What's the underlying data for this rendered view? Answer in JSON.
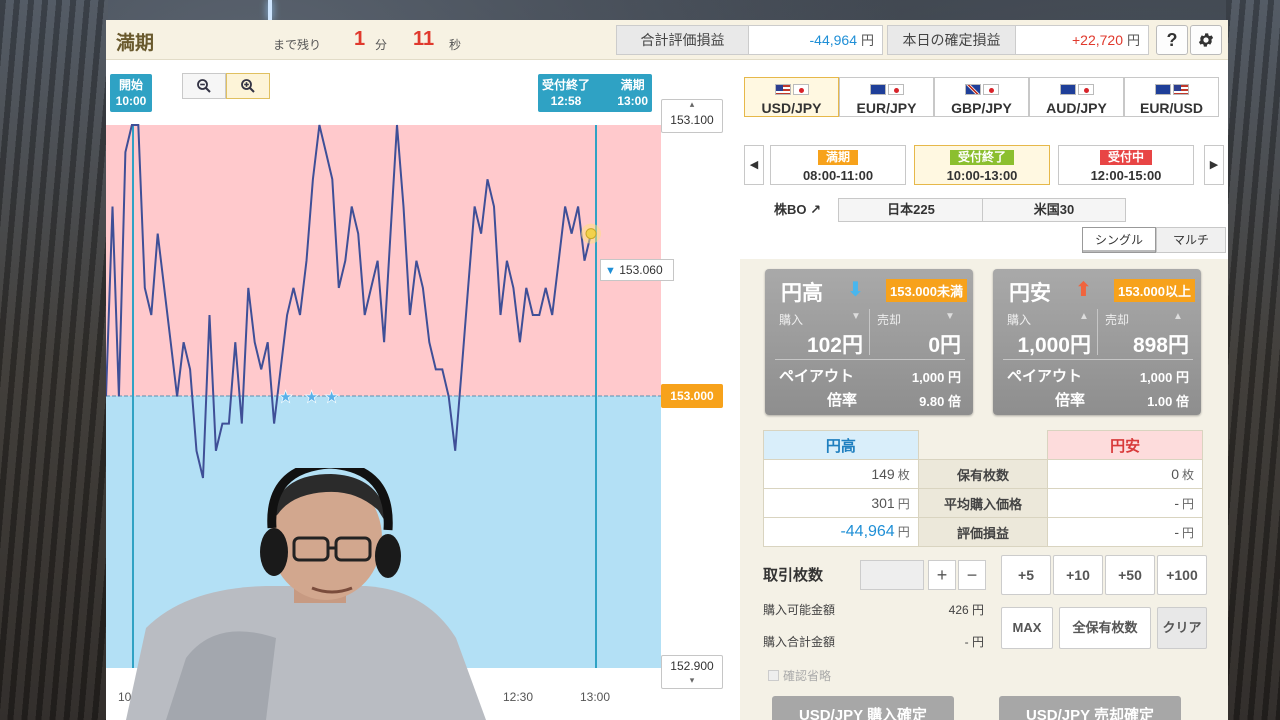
{
  "header": {
    "title": "満期",
    "remaining_label": "まで残り",
    "minutes": "1",
    "minutes_unit": "分",
    "seconds": "11",
    "seconds_unit": "秒",
    "total_pl_label": "合計評価損益",
    "total_pl_value": "-44,964",
    "today_pl_label": "本日の確定損益",
    "today_pl_value": "+22,720",
    "yen": "円",
    "help_icon": "?",
    "colors": {
      "negative": "#1f8fd6",
      "positive": "#e0392d"
    }
  },
  "chart": {
    "start_label": "開始",
    "start_time": "10:00",
    "close_label": "受付終了",
    "close_time": "12:58",
    "expiry_label": "満期",
    "expiry_time": "13:00",
    "upper_price": "153.100",
    "strike_price": "153.000",
    "lower_price": "152.900",
    "current_price": "153.060",
    "x_ticks": [
      "10",
      "12:30",
      "13:00"
    ],
    "zoom_out_icon": "zoom-out-icon",
    "zoom_in_icon": "zoom-in-icon"
  },
  "chart_data": {
    "type": "line",
    "x_label": "",
    "y_label": "",
    "ylim": [
      152.9,
      153.1
    ],
    "xlim": [
      "10:00",
      "13:00"
    ],
    "strike": 153.0,
    "series": [
      {
        "values": [
          153.0,
          153.07,
          153.0,
          153.09,
          153.1,
          153.1,
          153.04,
          153.03,
          153.06,
          153.04,
          153.02,
          153.0,
          153.02,
          153.01,
          152.98,
          152.97,
          153.03,
          152.98,
          152.99,
          152.99,
          153.02,
          152.99,
          153.04,
          153.02,
          153.01,
          153.02,
          152.99,
          153.01,
          153.03,
          153.04,
          153.03,
          153.05,
          153.08,
          153.1,
          153.09,
          153.08,
          153.04,
          153.05,
          153.07,
          153.06,
          153.03,
          153.04,
          153.05,
          153.02,
          153.06,
          153.1,
          153.07,
          153.03,
          153.05,
          153.04,
          153.02,
          153.01,
          153.01,
          153.0,
          152.98,
          153.01,
          153.04,
          153.07,
          153.06,
          153.08,
          153.07,
          153.03,
          153.05,
          153.04,
          153.02,
          153.04,
          153.03,
          153.03,
          153.04,
          153.03,
          153.05,
          153.07,
          153.06,
          153.07,
          153.05,
          153.06
        ]
      }
    ],
    "star_markers": 3
  },
  "pairs": [
    {
      "label": "USD/JPY",
      "flags": [
        "us",
        "jp"
      ],
      "active": true
    },
    {
      "label": "EUR/JPY",
      "flags": [
        "eu",
        "jp"
      ],
      "active": false
    },
    {
      "label": "GBP/JPY",
      "flags": [
        "gb",
        "jp"
      ],
      "active": false
    },
    {
      "label": "AUD/JPY",
      "flags": [
        "au",
        "jp"
      ],
      "active": false
    },
    {
      "label": "EUR/USD",
      "flags": [
        "eu",
        "us"
      ],
      "active": false
    }
  ],
  "sessions": [
    {
      "badge": "満期",
      "time": "08:00-11:00",
      "badge_color": "#f7a21b"
    },
    {
      "badge": "受付終了",
      "time": "10:00-13:00",
      "badge_color": "#8bbf2f"
    },
    {
      "badge": "受付中",
      "time": "12:00-15:00",
      "badge_color": "#e84545"
    }
  ],
  "stock": {
    "label": "株BO",
    "items": [
      "日本225",
      "米国30"
    ]
  },
  "modes": [
    "シングル",
    "マルチ"
  ],
  "cards": {
    "high": {
      "title": "円高",
      "condition": "153.000未満",
      "buy_label": "購入",
      "buy_value": "102円",
      "sell_label": "売却",
      "sell_value": "0円",
      "payout_label": "ペイアウト",
      "payout_value": "1,000 円",
      "rate_label": "倍率",
      "rate_value": "9.80 倍"
    },
    "low": {
      "title": "円安",
      "condition": "153.000以上",
      "buy_label": "購入",
      "buy_value": "1,000円",
      "sell_label": "売却",
      "sell_value": "898円",
      "payout_label": "ペイアウト",
      "payout_value": "1,000 円",
      "rate_label": "倍率",
      "rate_value": "1.00 倍"
    }
  },
  "positions": {
    "high_header": "円高",
    "low_header": "円安",
    "rows": [
      {
        "label": "保有枚数",
        "high": "149",
        "high_unit": "枚",
        "low": "0",
        "low_unit": "枚"
      },
      {
        "label": "平均購入価格",
        "high": "301",
        "high_unit": "円",
        "low": "-",
        "low_unit": "円"
      },
      {
        "label": "評価損益",
        "high": "-44,964",
        "high_unit": "円",
        "low": "-",
        "low_unit": "円"
      }
    ]
  },
  "order": {
    "qty_label": "取引枚数",
    "plus": "+",
    "minus": "−",
    "steps": [
      "+5",
      "+10",
      "+50",
      "+100"
    ],
    "max": "MAX",
    "all_holdings": "全保有枚数",
    "clear": "クリア",
    "available_label": "購入可能金額",
    "available_value": "426 円",
    "total_label": "購入合計金額",
    "total_value": "- 円",
    "confirm_skip": "確認省略",
    "buy_confirm": "USD/JPY 購入確定",
    "sell_confirm": "USD/JPY 売却確定"
  }
}
